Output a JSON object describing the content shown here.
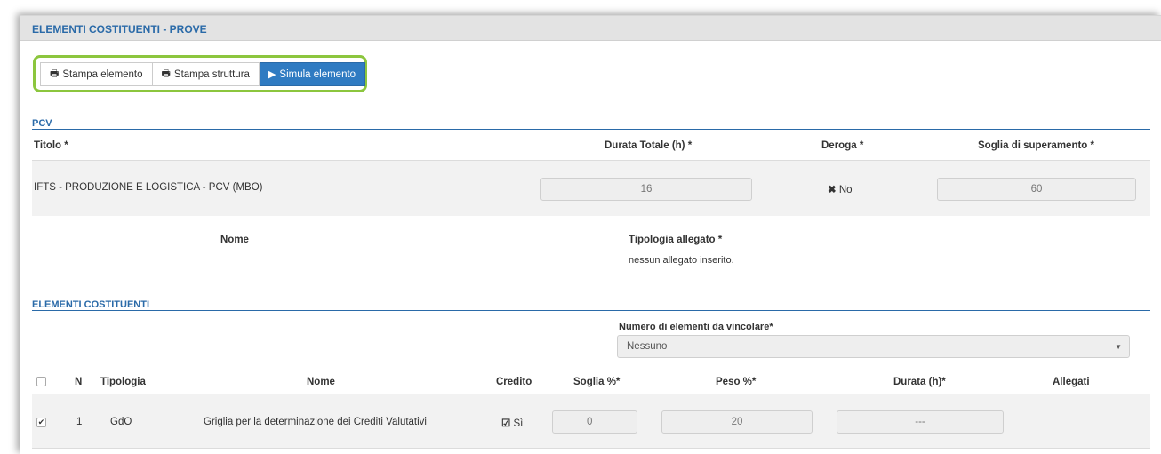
{
  "panel": {
    "title": "ELEMENTI COSTITUENTI - PROVE"
  },
  "toolbar": {
    "print_element": "Stampa elemento",
    "print_structure": "Stampa struttura",
    "simulate_element": "Simula elemento"
  },
  "pcv": {
    "section_title": "PCV",
    "headers": {
      "title": "Titolo *",
      "duration": "Durata Totale (h) *",
      "deroga": "Deroga *",
      "threshold": "Soglia di superamento *"
    },
    "row": {
      "title": "IFTS - PRODUZIONE E LOGISTICA - PCV (MBO)",
      "duration": "16",
      "deroga": "No",
      "threshold": "60"
    },
    "attachments": {
      "col_name": "Nome",
      "col_type": "Tipologia allegato *",
      "empty_text": "nessun allegato inserito."
    }
  },
  "elements": {
    "section_title": "ELEMENTI COSTITUENTI",
    "constraint_label": "Numero di elementi da vincolare*",
    "constraint_value": "Nessuno",
    "headers": {
      "n": "N",
      "type": "Tipologia",
      "name": "Nome",
      "credit": "Credito",
      "threshold": "Soglia %*",
      "weight": "Peso %*",
      "duration": "Durata (h)*",
      "attachments": "Allegati"
    },
    "rows": [
      {
        "checked": true,
        "n": "1",
        "type": "GdO",
        "name": "Griglia per la determinazione dei Crediti Valutativi",
        "credit": "Sì",
        "threshold": "0",
        "weight": "20",
        "duration": "---"
      }
    ]
  },
  "colors": {
    "accent": "#2a6aa8",
    "primary_button": "#2f7bc2",
    "highlight": "#8cc63e"
  }
}
